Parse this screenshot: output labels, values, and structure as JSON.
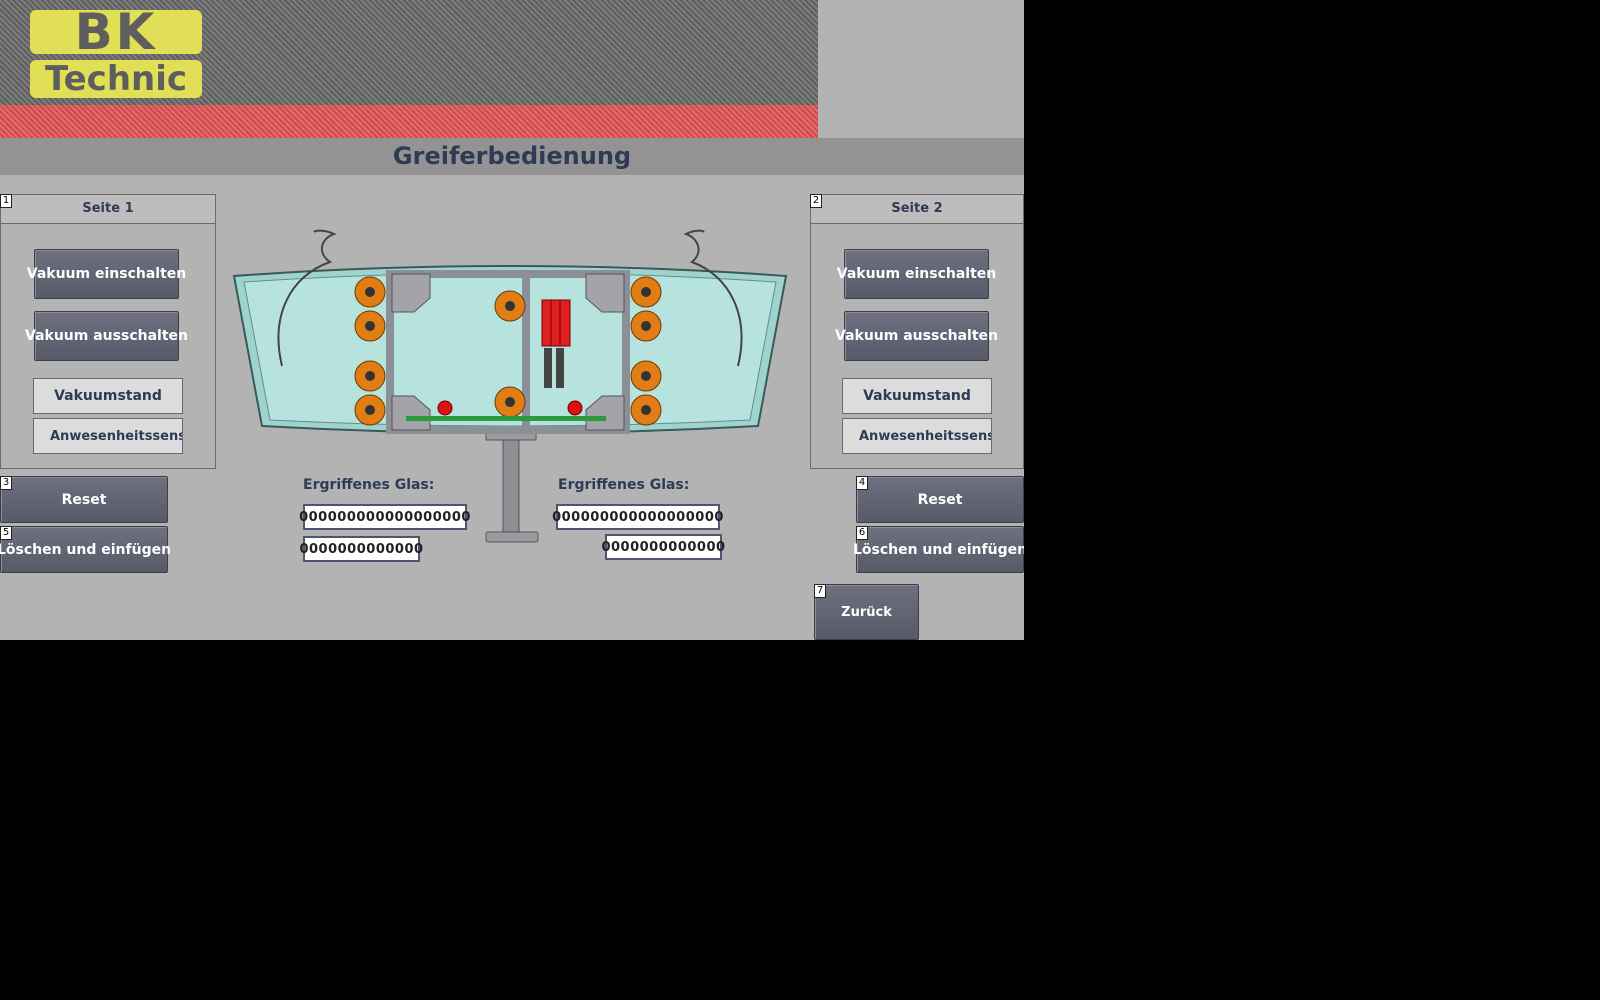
{
  "logo": {
    "line1": "BK",
    "line2": "Technic"
  },
  "header": {
    "title": "Greiferbedienung"
  },
  "side1": {
    "tag": "1",
    "title": "Seite 1",
    "vacuum_on": "Vakuum einschalten",
    "vacuum_off": "Vakuum ausschalten",
    "vacuum_level": "Vakuumstand",
    "presence_sensor": "Anwesenheitssensor"
  },
  "side2": {
    "tag": "2",
    "title": "Seite 2",
    "vacuum_on": "Vakuum einschalten",
    "vacuum_off": "Vakuum ausschalten",
    "vacuum_level": "Vakuumstand",
    "presence_sensor": "Anwesenheitssensor"
  },
  "reset_left": {
    "tag": "3",
    "label": "Reset"
  },
  "reset_right": {
    "tag": "4",
    "label": "Reset"
  },
  "clear_left": {
    "tag": "5",
    "label": "Löschen und einfügen"
  },
  "clear_right": {
    "tag": "6",
    "label": "Löschen und einfügen"
  },
  "back": {
    "tag": "7",
    "label": "Zurück"
  },
  "glass_left": {
    "label": "Ergriffenes Glas:",
    "value1": "000000000000000000",
    "value2": "0000000000000"
  },
  "glass_right": {
    "label": "Ergriffenes Glas:",
    "value1": "000000000000000000",
    "value2": "0000000000000"
  },
  "colors": {
    "background": "#b3b3b3",
    "title_bar": "#939393",
    "button": "#616372",
    "logo": "#e0df55",
    "banner_red": "#d85a5a",
    "text": "#2f3a55"
  }
}
